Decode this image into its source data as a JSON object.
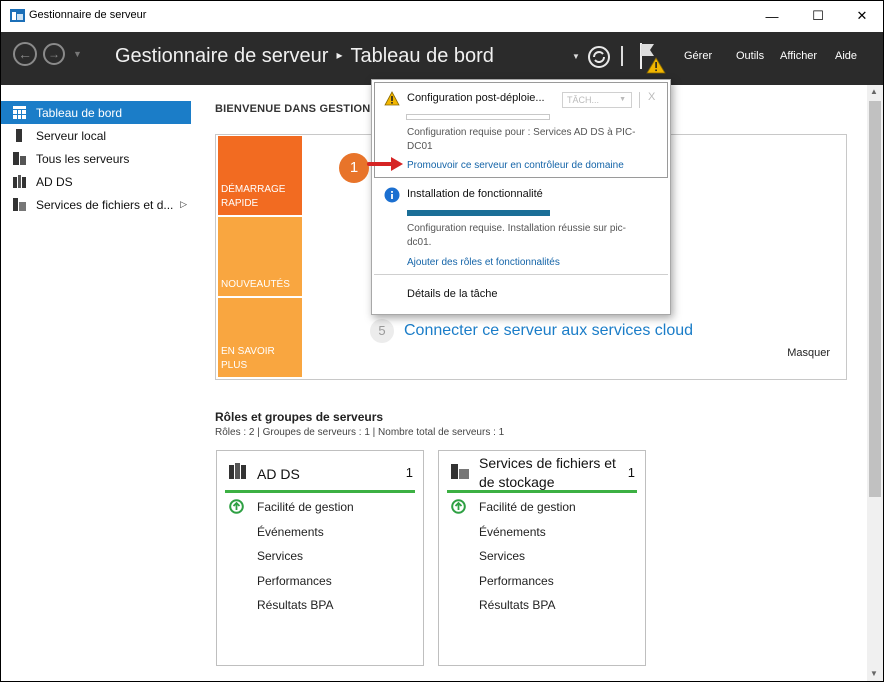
{
  "window": {
    "title": "Gestionnaire de serveur",
    "controls": {
      "minimize": "—",
      "maximize": "☐",
      "close": "✕"
    }
  },
  "header": {
    "app_name": "Gestionnaire de serveur",
    "separator": "▸",
    "page": "Tableau de bord",
    "menu": [
      "Gérer",
      "Outils",
      "Afficher",
      "Aide"
    ]
  },
  "sidebar": {
    "items": [
      {
        "label": "Tableau de bord",
        "icon": "dashboard-icon",
        "active": true
      },
      {
        "label": "Serveur local",
        "icon": "server-icon"
      },
      {
        "label": "Tous les serveurs",
        "icon": "servers-icon"
      },
      {
        "label": "AD DS",
        "icon": "ad-ds-icon"
      },
      {
        "label": "Services de fichiers et d...",
        "icon": "file-services-icon",
        "arrow": "▷"
      }
    ]
  },
  "welcome": {
    "title": "BIENVENUE DANS GESTION",
    "tiles": [
      "DÉMARRAGE RAPIDE",
      "NOUVEAUTÉS",
      "EN SAVOIR PLUS"
    ],
    "step5_number": "5",
    "step5_label": "Connecter ce serveur aux services cloud",
    "hide": "Masquer"
  },
  "roles": {
    "title": "Rôles et groupes de serveurs",
    "subtitle": "Rôles : 2   |   Groupes de serveurs : 1   |   Nombre total de serveurs : 1",
    "cards": [
      {
        "title": "AD DS",
        "count": "1",
        "rows": [
          "Facilité de gestion",
          "Événements",
          "Services",
          "Performances",
          "Résultats BPA"
        ]
      },
      {
        "title": "Services de fichiers et de stockage",
        "count": "1",
        "rows": [
          "Facilité de gestion",
          "Événements",
          "Services",
          "Performances",
          "Résultats BPA"
        ]
      }
    ]
  },
  "notification": {
    "item1": {
      "title": "Configuration post-déploie...",
      "task_button": "TÂCH...",
      "close": "X",
      "text": "Configuration requise pour : Services AD DS à PIC-DC01",
      "link": "Promouvoir ce serveur en contrôleur de domaine"
    },
    "item2": {
      "title": "Installation de fonctionnalité",
      "text": "Configuration requise. Installation réussie sur pic-dc01.",
      "link": "Ajouter des rôles et fonctionnalités",
      "progress": 1.0
    },
    "details": "Détails de la tâche"
  },
  "callout": {
    "number": "1"
  },
  "colors": {
    "accent": "#1b7dc8",
    "header_bg": "#2b2b2b",
    "tile_orange": "#f26b21",
    "tile_amber": "#f9a640",
    "status_green": "#3cb043",
    "callout_arrow": "#d62424"
  }
}
